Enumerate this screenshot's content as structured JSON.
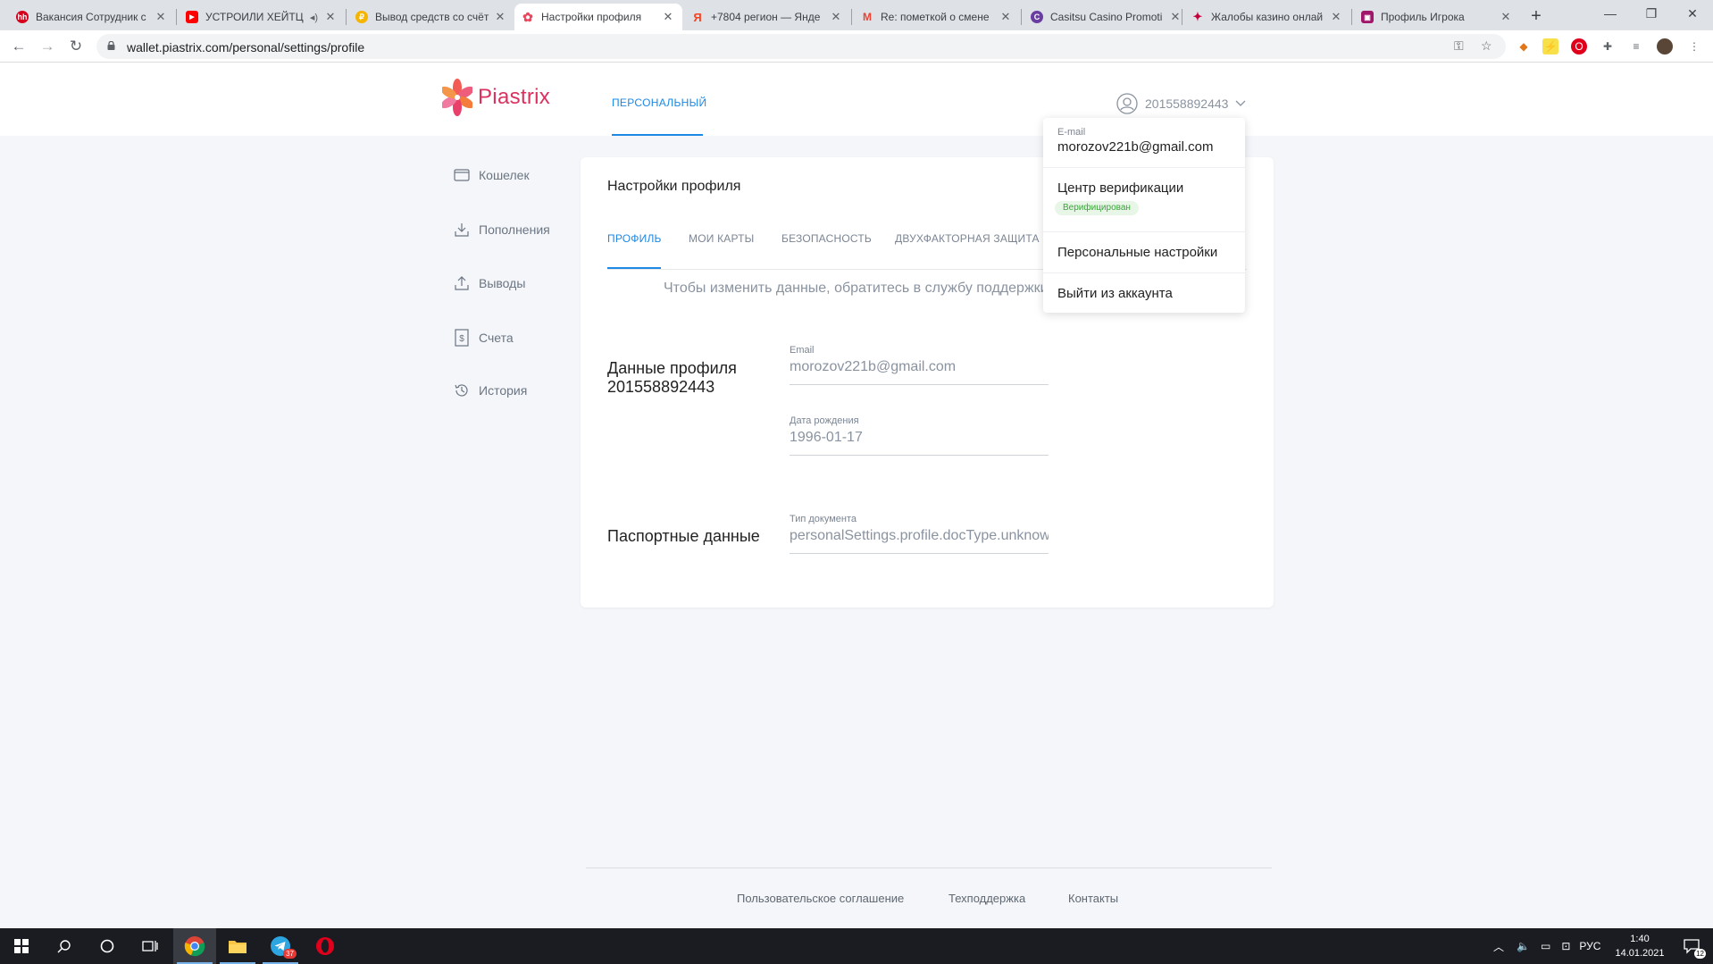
{
  "browser": {
    "tabs": [
      {
        "title": "Вакансия Сотрудник с",
        "favicon_color": "#d6001c",
        "favicon_text": "hh"
      },
      {
        "title": "УСТРОИЛИ ХЕЙТЦ",
        "favicon_color": "#ff0000",
        "favicon_text": "▶"
      },
      {
        "title": "Вывод средств со счёт",
        "favicon_color": "#f5b400",
        "favicon_text": "₽"
      },
      {
        "title": "Настройки профиля",
        "favicon_color": "#e8475d",
        "favicon_text": "✿"
      },
      {
        "title": "+7804 регион — Янде",
        "favicon_color": "#ffffff",
        "favicon_text": "Я"
      },
      {
        "title": "Re: пометкой о смене",
        "favicon_color": "#ffffff",
        "favicon_text": "M"
      },
      {
        "title": "Casitsu Casino Promoti",
        "favicon_color": "#6a3ea1",
        "favicon_text": "C"
      },
      {
        "title": "Жалобы казино онлай",
        "favicon_color": "#c4003a",
        "favicon_text": "✦"
      },
      {
        "title": "Профиль Игрока",
        "favicon_color": "#a0166a",
        "favicon_text": "▣"
      }
    ],
    "url": "wallet.piastrix.com/personal/settings/profile"
  },
  "header": {
    "logo_text": "Piastrix",
    "nav_personal": "ПЕРСОНАЛЬНЫЙ",
    "user_id": "201558892443"
  },
  "sidebar": {
    "items": [
      {
        "label": "Кошелек",
        "icon": "wallet-icon"
      },
      {
        "label": "Пополнения",
        "icon": "download-icon"
      },
      {
        "label": "Выводы",
        "icon": "upload-icon"
      },
      {
        "label": "Счета",
        "icon": "invoice-icon"
      },
      {
        "label": "История",
        "icon": "history-icon"
      }
    ]
  },
  "card": {
    "title": "Настройки профиля",
    "tabs": [
      "ПРОФИЛЬ",
      "МОИ КАРТЫ",
      "БЕЗОПАСНОСТЬ",
      "ДВУХФАКТОРНАЯ ЗАЩИТА"
    ],
    "notice": "Чтобы изменить данные, обратитесь в службу поддержки",
    "profile_section": {
      "label": "Данные профиля",
      "id": "201558892443"
    },
    "fields": {
      "email_label": "Email",
      "email_value": "morozov221b@gmail.com",
      "dob_label": "Дата рождения",
      "dob_value": "1996-01-17",
      "doctype_label": "Тип документа",
      "doctype_value": "personalSettings.profile.docType.unknown"
    },
    "passport_label": "Паспортные данные"
  },
  "dropdown": {
    "email_label": "E-mail",
    "email": "morozov221b@gmail.com",
    "verification": "Центр верификации",
    "verified_badge": "Верифицирован",
    "personal_settings": "Персональные настройки",
    "logout": "Выйти из аккаунта"
  },
  "footer": {
    "links": [
      "Пользовательское соглашение",
      "Техподдержка",
      "Контакты"
    ]
  },
  "taskbar": {
    "telegram_badge": "37",
    "lang": "РУС",
    "time": "1:40",
    "date": "14.01.2021",
    "notifications": "12"
  },
  "colors": {
    "accent": "#1e88e5",
    "brand": "#d9325f",
    "verified": "#3aa43a"
  }
}
